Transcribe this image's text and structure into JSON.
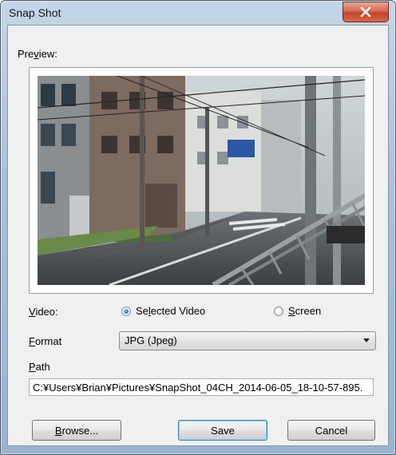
{
  "window": {
    "title": "Snap Shot"
  },
  "preview": {
    "label_pre": "Pre",
    "label_accel": "v",
    "label_post": "iew:"
  },
  "video": {
    "label_accel": "V",
    "label_post": "ideo:",
    "options": [
      {
        "pre": "Se",
        "accel": "l",
        "post": "ected Video",
        "selected": true
      },
      {
        "pre": "",
        "accel": "S",
        "post": "creen",
        "selected": false
      }
    ]
  },
  "format": {
    "label_accel": "F",
    "label_post": "ormat",
    "value": "JPG (Jpeg)"
  },
  "path": {
    "label_accel": "P",
    "label_post": "ath",
    "value": "C:¥Users¥Brian¥Pictures¥SnapShot_04CH_2014-06-05_18-10-57-895."
  },
  "buttons": {
    "browse": {
      "accel": "B",
      "post": "rowse..."
    },
    "save": "Save",
    "cancel": "Cancel"
  },
  "colors": {
    "accent": "#3c7fb1",
    "close": "#c2432a"
  },
  "icons": {
    "close": "close-icon"
  }
}
